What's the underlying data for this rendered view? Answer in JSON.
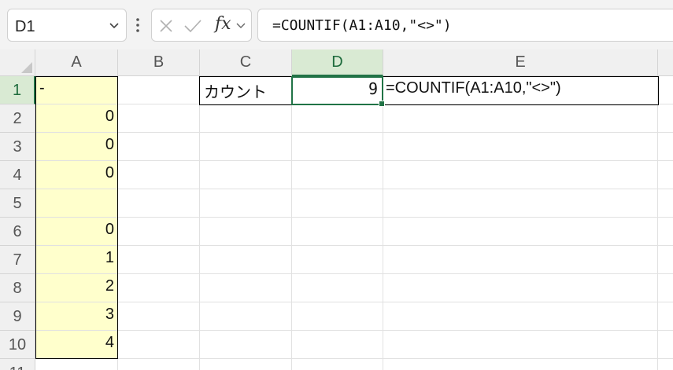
{
  "name_box": {
    "value": "D1"
  },
  "formula_bar": {
    "fx_label": "fx",
    "value": "=COUNTIF(A1:A10,\"<>\")"
  },
  "columns": [
    "A",
    "B",
    "C",
    "D",
    "E"
  ],
  "rows": [
    "1",
    "2",
    "3",
    "4",
    "5",
    "6",
    "7",
    "8",
    "9",
    "10",
    "11"
  ],
  "selected_cell": "D1",
  "cells": {
    "A1": "-",
    "A2": "0",
    "A3": "0",
    "A4": "0",
    "A5": "",
    "A6": "0",
    "A7": "1",
    "A8": "2",
    "A9": "3",
    "A10": "4",
    "C1": "カウント",
    "D1": "9",
    "E1": "=COUNTIF(A1:A10,\"<>\")"
  },
  "colors": {
    "highlight_fill": "#ffffcc",
    "selection": "#217346"
  }
}
